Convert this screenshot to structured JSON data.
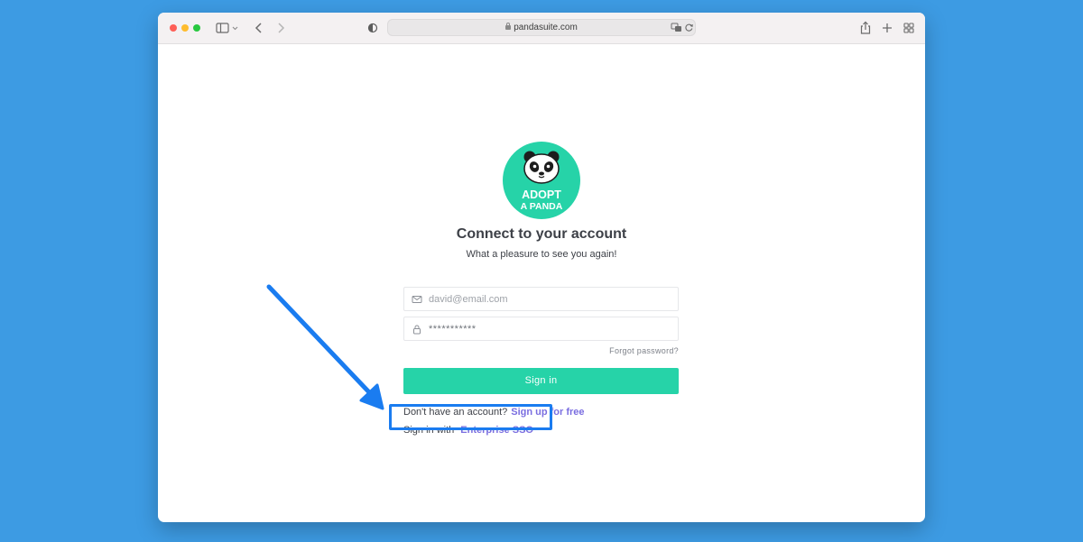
{
  "browser": {
    "url": "pandasuite.com",
    "icons": {
      "sidebar": "sidebar-icon",
      "back": "chevron-left-icon",
      "forward": "chevron-right-icon",
      "privacy": "shield-half-icon",
      "translate": "translate-icon",
      "reload": "reload-icon",
      "share": "share-icon",
      "new_tab": "plus-icon",
      "tabs": "tab-overview-icon"
    }
  },
  "login": {
    "logo_text_line1": "ADOPT",
    "logo_text_line2": "A PANDA",
    "title": "Connect to your account",
    "subtitle": "What a pleasure to see you again!",
    "email_placeholder": "david@email.com",
    "password_value": "***********",
    "forgot_label": "Forgot password?",
    "signin_label": "Sign in",
    "no_account_text": "Don't have an account?",
    "signup_label": "Sign up for free",
    "sso_prefix": "Sign in with",
    "sso_label": "Enterprise SSO"
  },
  "colors": {
    "background": "#3d9be3",
    "brand_green": "#26d3a8",
    "link_purple": "#7a6ee0",
    "highlight_blue": "#1a7cf0"
  }
}
